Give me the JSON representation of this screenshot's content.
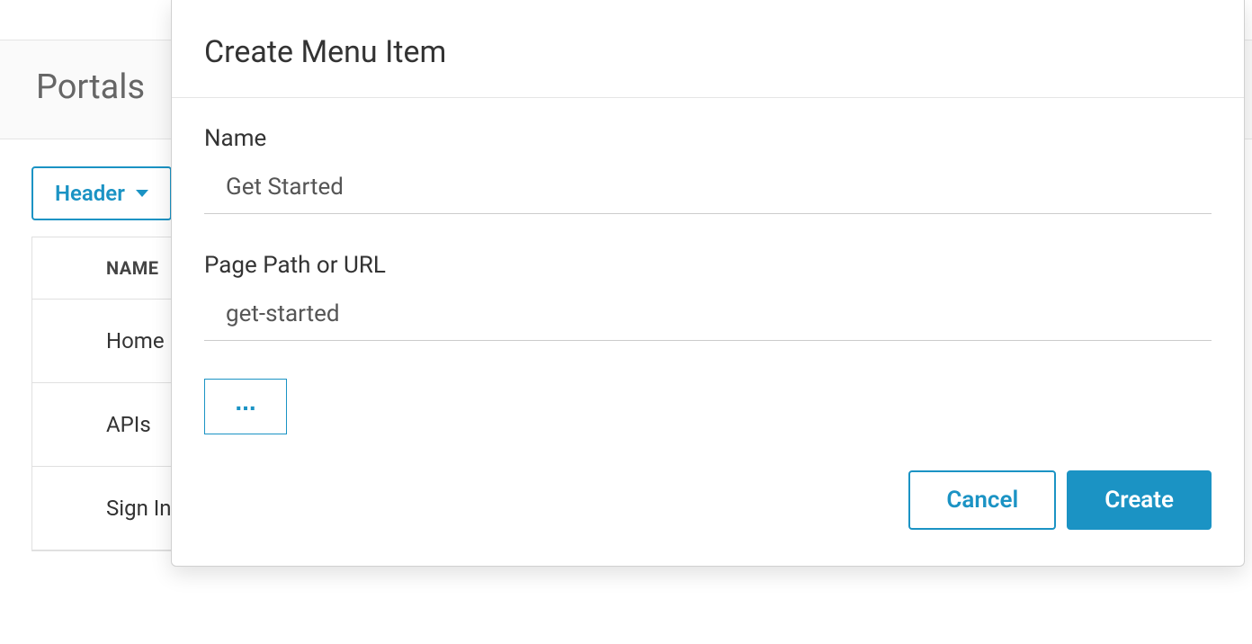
{
  "page": {
    "title": "Portals"
  },
  "dropdown": {
    "label": "Header"
  },
  "table": {
    "column_header": "NAME",
    "rows": [
      {
        "label": "Home"
      },
      {
        "label": "APIs"
      },
      {
        "label": "Sign In"
      }
    ]
  },
  "modal": {
    "title": "Create Menu Item",
    "name_label": "Name",
    "name_value": "Get Started",
    "path_label": "Page Path or URL",
    "path_value": "get-started",
    "more_label": "...",
    "cancel_label": "Cancel",
    "create_label": "Create"
  }
}
